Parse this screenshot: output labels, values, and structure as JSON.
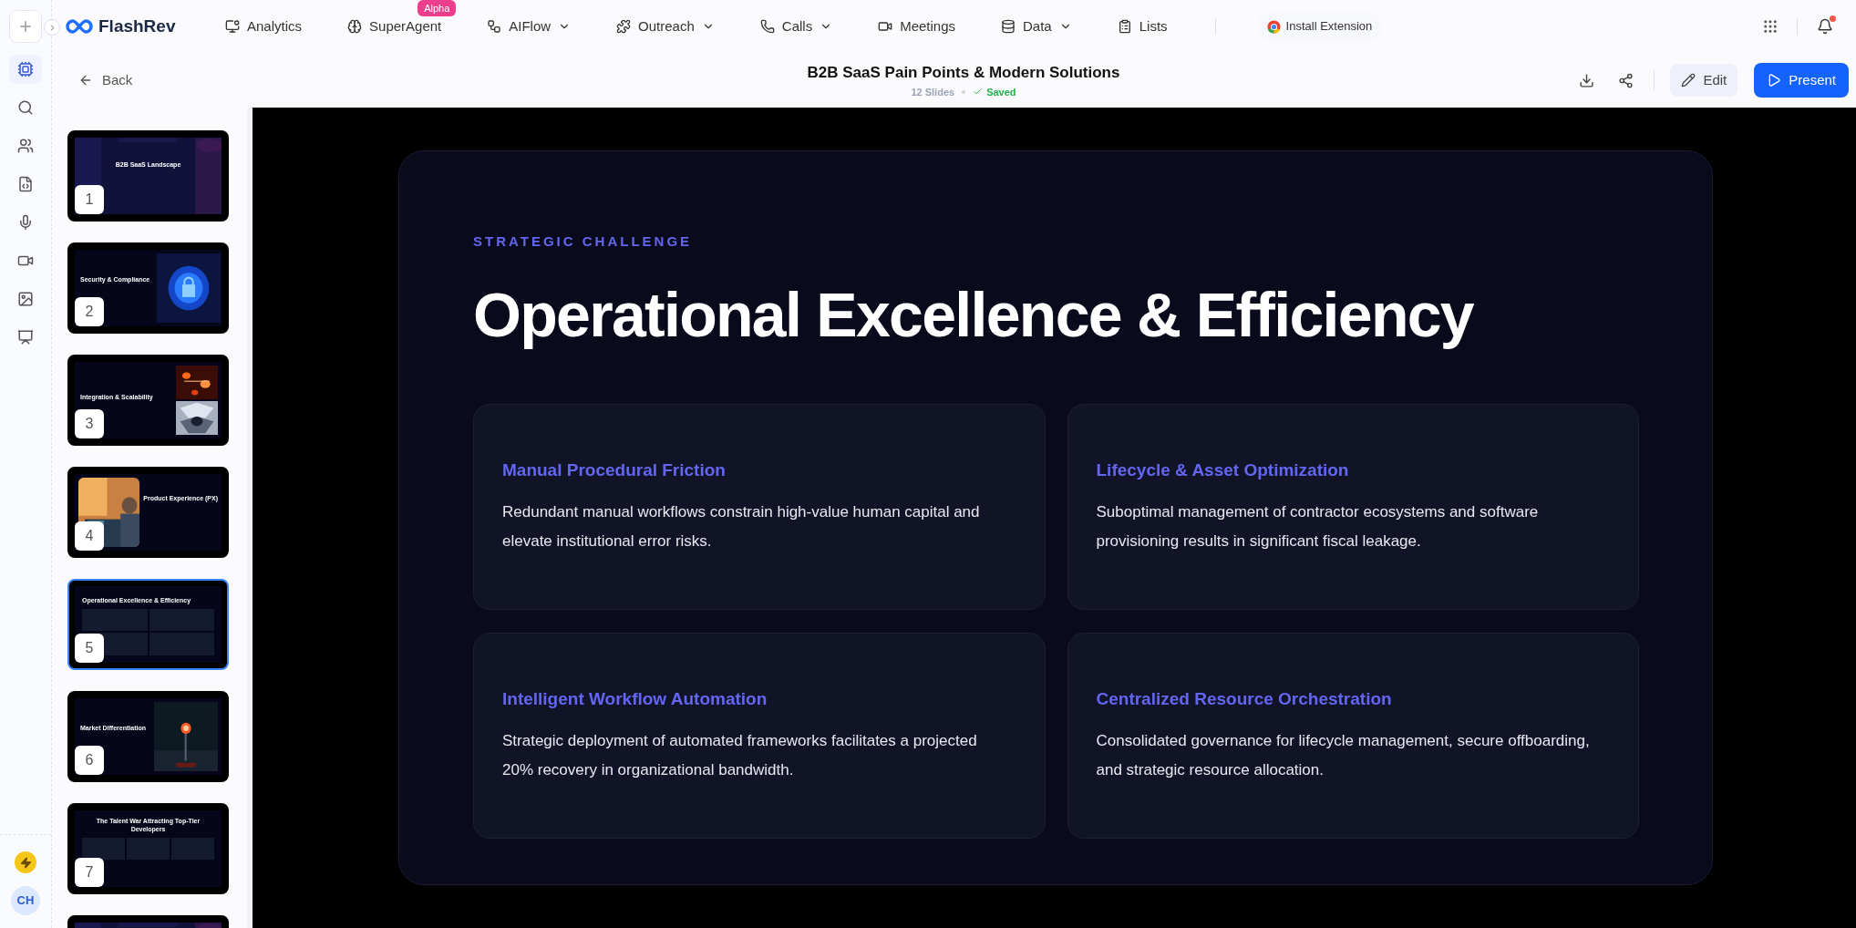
{
  "rail": {
    "items": [
      {
        "selected": true
      },
      {
        "selected": false
      },
      {
        "selected": false
      },
      {
        "selected": false
      },
      {
        "selected": false
      },
      {
        "selected": false
      },
      {
        "selected": false
      },
      {
        "selected": false
      }
    ],
    "user_initials": "CH"
  },
  "nav": {
    "brand": "FlashRev",
    "items": [
      {
        "label": "Analytics",
        "dropdown": false
      },
      {
        "label": "SuperAgent",
        "dropdown": false,
        "badge": "Alpha"
      },
      {
        "label": "AIFlow",
        "dropdown": true
      },
      {
        "label": "Outreach",
        "dropdown": true
      },
      {
        "label": "Calls",
        "dropdown": true
      },
      {
        "label": "Meetings",
        "dropdown": false
      },
      {
        "label": "Data",
        "dropdown": true
      },
      {
        "label": "Lists",
        "dropdown": false
      }
    ],
    "extension": "Install Extension",
    "notification": true
  },
  "header": {
    "back": "Back",
    "title": "B2B SaaS Pain Points & Modern Solutions",
    "count": "12 Slides",
    "status": "Saved",
    "edit": "Edit",
    "present": "Present"
  },
  "slides": [
    {
      "number": "1",
      "title": "B2B SaaS Landscape",
      "kind": "background",
      "selected": false
    },
    {
      "number": "2",
      "title": "Security & Compliance",
      "kind": "right",
      "selected": false
    },
    {
      "number": "3",
      "title": "Integration & Scalability",
      "kind": "double",
      "selected": false
    },
    {
      "number": "4",
      "title": "Product Experience (PX)",
      "kind": "left",
      "selected": false
    },
    {
      "number": "5",
      "title": "Operational Excellence & Efficiency",
      "kind": "grid",
      "selected": true
    },
    {
      "number": "6",
      "title": "Market Differentiation",
      "kind": "right",
      "selected": false
    },
    {
      "number": "7",
      "title": "The Talent War Attracting Top-Tier Developers",
      "kind": "cards",
      "selected": false
    },
    {
      "kind": "background",
      "selected": false
    }
  ],
  "slide": {
    "eyebrow": "STRATEGIC CHALLENGE",
    "title": "Operational Excellence & Efficiency",
    "cards": [
      {
        "title": "Manual Procedural Friction",
        "body": "Redundant manual workflows constrain high-value human capital and elevate institutional error risks."
      },
      {
        "title": "Lifecycle & Asset Optimization",
        "body": "Suboptimal management of contractor ecosystems and software provisioning results in significant fiscal leakage."
      },
      {
        "title": "Intelligent Workflow Automation",
        "body": "Strategic deployment of automated frameworks facilitates a projected 20% recovery in organizational bandwidth."
      },
      {
        "title": "Centralized Resource Orchestration",
        "body": "Consolidated governance for lifecycle management, secure offboarding, and strategic resource allocation."
      }
    ]
  }
}
